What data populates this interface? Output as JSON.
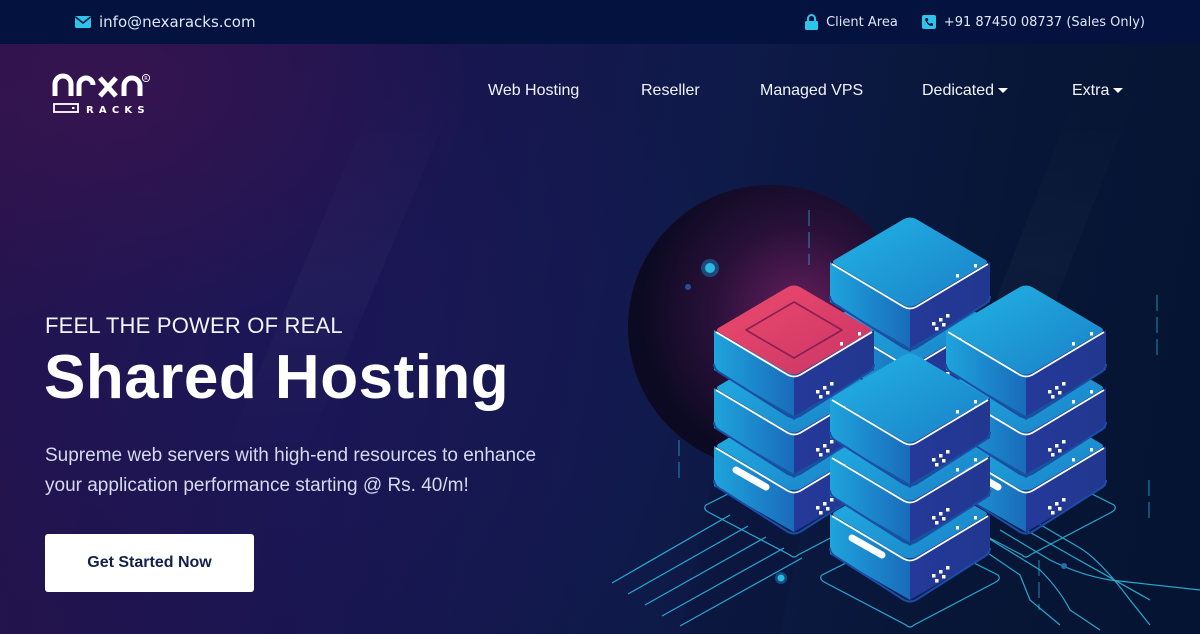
{
  "topbar": {
    "email": {
      "icon": "envelope-icon",
      "text": "info@nexaracks.com"
    },
    "client_area": {
      "icon": "lock-icon",
      "text": "Client Area"
    },
    "phone": {
      "icon": "phone-icon",
      "text": "+91 87450 08737 (Sales Only)"
    }
  },
  "brand": {
    "name": "nexa",
    "sub": "RACKS",
    "registered": "®"
  },
  "nav": {
    "items": [
      {
        "label": "Web Hosting",
        "dropdown": false
      },
      {
        "label": "Reseller",
        "dropdown": false
      },
      {
        "label": "Managed VPS",
        "dropdown": false
      },
      {
        "label": "Dedicated",
        "dropdown": true
      },
      {
        "label": "Extra",
        "dropdown": true
      }
    ]
  },
  "hero": {
    "eyebrow": "FEEL THE POWER OF REAL",
    "headline": "Shared Hosting",
    "subtext_line1": "Supreme web servers with high-end resources to enhance",
    "subtext_line2": "your application performance starting @ Rs. 40/m!",
    "cta_label": "Get Started Now"
  },
  "illustration": {
    "subject": "isometric-server-stacks",
    "accent_highlight": "#e0426a"
  },
  "colors": {
    "topbar_bg": "#03123f",
    "icon_accent": "#2ec4ea",
    "server_blue": "#1fa3dd",
    "server_dark": "#23358f",
    "circuit_line": "#2bb8e0"
  }
}
